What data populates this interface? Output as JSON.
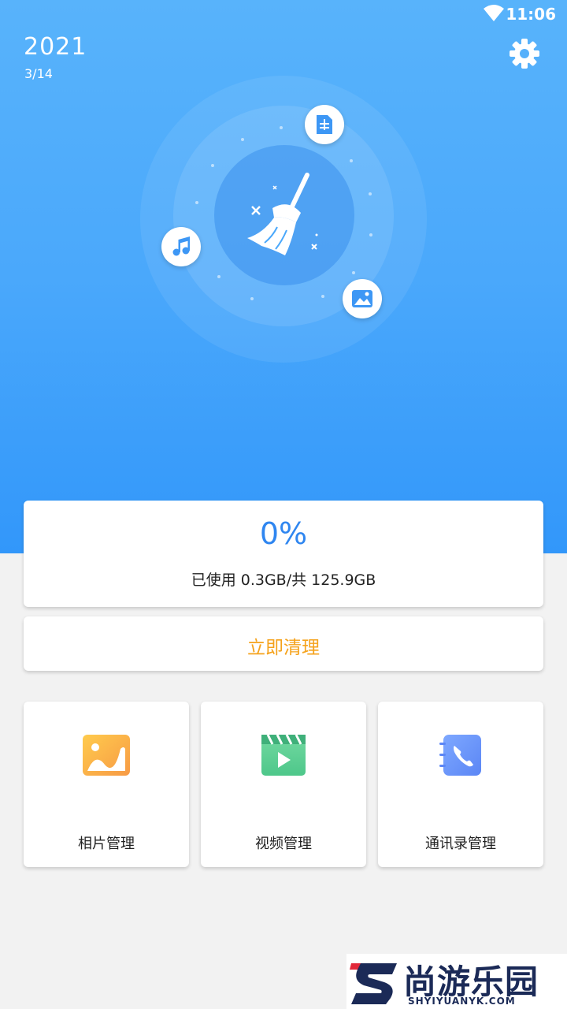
{
  "status_bar": {
    "time": "11:06"
  },
  "header": {
    "year": "2021",
    "date": "3/14"
  },
  "storage": {
    "percent": "0%",
    "usage_text": "已使用 0.3GB/共 125.9GB"
  },
  "actions": {
    "clean_label": "立即清理"
  },
  "tiles": [
    {
      "label": "相片管理",
      "icon": "photo-icon"
    },
    {
      "label": "视频管理",
      "icon": "video-icon"
    },
    {
      "label": "通讯录管理",
      "icon": "contacts-icon"
    }
  ],
  "watermark": {
    "text": "尚游乐园",
    "url": "SHYIYUANYK.COM"
  },
  "colors": {
    "hero_top": "#58b3fb",
    "hero_bottom": "#3297fa",
    "percent": "#2f86f0",
    "clean_label": "#f5a21b"
  }
}
